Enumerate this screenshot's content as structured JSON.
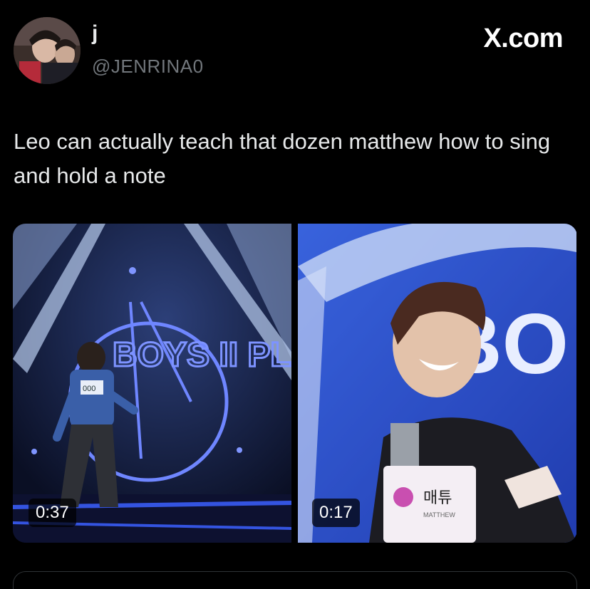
{
  "author": {
    "display_name": "j",
    "handle": "@JENRINA0",
    "avatar_icon": "profile-photo-avatar"
  },
  "brand": {
    "label": "X.com"
  },
  "tweet": {
    "text": "Leo can actually teach that dozen matthew how to sing and hold a note"
  },
  "media": [
    {
      "kind": "video",
      "duration": "0:37",
      "stage_text": "BOYS II PLANET",
      "badge": "000"
    },
    {
      "kind": "video",
      "duration": "0:17",
      "stage_text": "BO",
      "tag_korean": "매튜",
      "tag_name": "MATTHEW"
    }
  ],
  "colors": {
    "background": "#000000",
    "text_primary": "#e7e9ea",
    "text_secondary": "#71767b",
    "border": "#2f3336"
  }
}
